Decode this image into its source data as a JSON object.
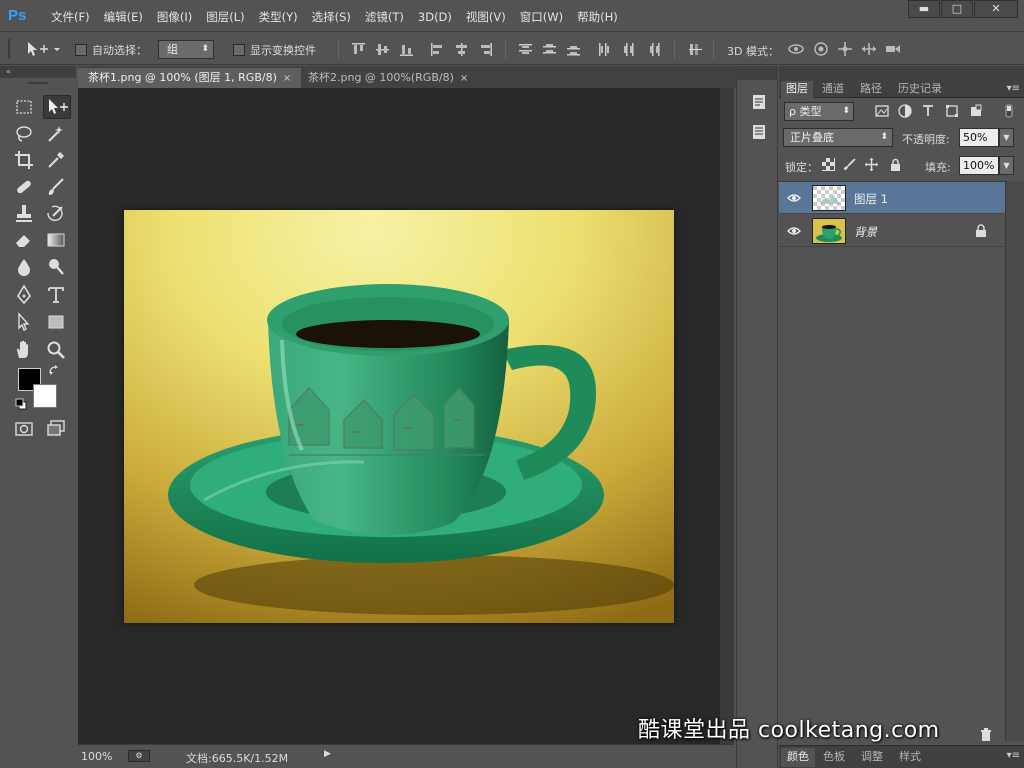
{
  "app": {
    "logo": "Ps"
  },
  "menu": [
    "文件(F)",
    "编辑(E)",
    "图像(I)",
    "图层(L)",
    "类型(Y)",
    "选择(S)",
    "滤镜(T)",
    "3D(D)",
    "视图(V)",
    "窗口(W)",
    "帮助(H)"
  ],
  "window_controls": {
    "minimize": "▬",
    "maximize": "□",
    "close": "✕"
  },
  "options": {
    "auto_select_label": "自动选择：",
    "auto_select_value": "组",
    "show_transform_label": "显示变换控件",
    "mode_3d_label": "3D 模式："
  },
  "tabs": [
    {
      "label": "茶杯1.png @ 100% (图层 1, RGB/8)",
      "close": "×",
      "active": true
    },
    {
      "label": "茶杯2.png @ 100%(RGB/8)",
      "close": "×",
      "active": false
    }
  ],
  "status": {
    "zoom": "100%",
    "doc_info": "文档:665.5K/1.52M"
  },
  "panel_tabs": [
    "图层",
    "通道",
    "路径",
    "历史记录"
  ],
  "layers_panel": {
    "filter_label": "ρ 类型",
    "blend_mode": "正片叠底",
    "opacity_label": "不透明度:",
    "opacity_value": "50%",
    "lock_label": "锁定：",
    "fill_label": "填充:",
    "fill_value": "100%"
  },
  "layers": [
    {
      "name": "图层 1",
      "selected": true,
      "locked": false
    },
    {
      "name": "背景",
      "selected": false,
      "locked": true
    }
  ],
  "bottom_tabs": [
    "颜色",
    "色板",
    "调整",
    "样式"
  ],
  "watermark": "酷课堂出品 coolketang.com",
  "colors": {
    "foreground": "#000000",
    "background": "#ffffff",
    "selected_layer": "#597698",
    "ps_blue": "#2fa3ff"
  }
}
